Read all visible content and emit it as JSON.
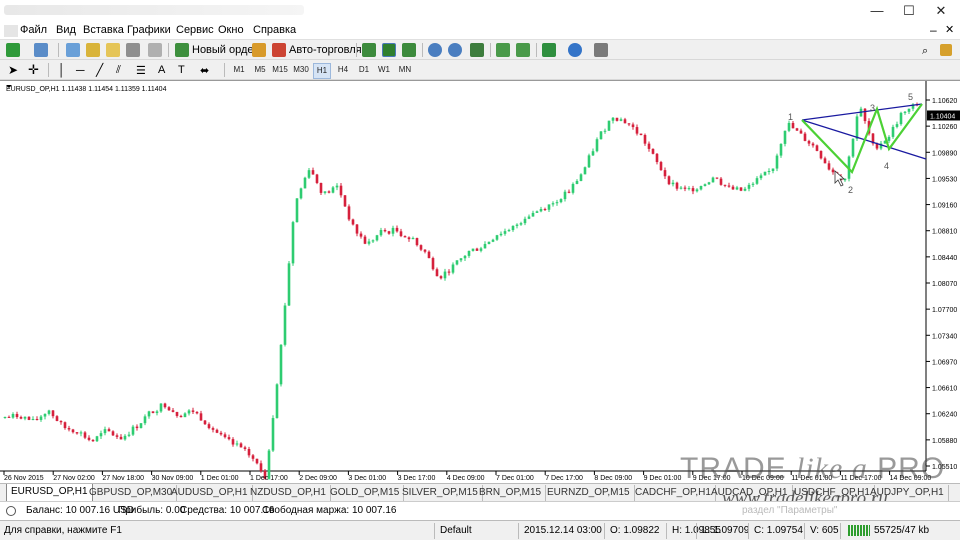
{
  "window": {
    "minimize": "—",
    "maximize": "☐",
    "close": "✕"
  },
  "menu": [
    "Файл",
    "Вид",
    "Вставка",
    "Графики",
    "Сервис",
    "Окно",
    "Справка"
  ],
  "toolbar": {
    "new_order": "Новый ордер",
    "auto_trading": "Авто-торговля"
  },
  "timeframes": [
    "M1",
    "M5",
    "M15",
    "M30",
    "H1",
    "H4",
    "D1",
    "W1",
    "MN"
  ],
  "active_timeframe": "H1",
  "chart": {
    "header": "EURUSD_OP,H1  1.11438 1.11454 1.11359 1.11404",
    "current_price": "1.10404",
    "bull_color": "#2ecc71",
    "bear_color": "#d6203c",
    "pattern_color": "#4cd135",
    "trendline_color": "#1a1aa0",
    "pattern_labels": [
      "1",
      "2",
      "3",
      "4",
      "5"
    ]
  },
  "chart_data": {
    "type": "candlestick",
    "symbol": "EURUSD_OP",
    "timeframe": "H1",
    "ohlc_last": {
      "open": 1.11438,
      "high": 1.11454,
      "low": 1.11359,
      "close": 1.11404
    },
    "y_ticks": [
      "1.10620",
      "1.10260",
      "1.09890",
      "1.09530",
      "1.09160",
      "1.08810",
      "1.08440",
      "1.08070",
      "1.07700",
      "1.07340",
      "1.06970",
      "1.06610",
      "1.06240",
      "1.05880",
      "1.05510"
    ],
    "x_ticks": [
      "26 Nov 2015",
      "27 Nov 02:00",
      "27 Nov 18:00",
      "30 Nov 09:00",
      "1 Dec 01:00",
      "1 Dec 17:00",
      "2 Dec 09:00",
      "3 Dec 01:00",
      "3 Dec 17:00",
      "4 Dec 09:00",
      "7 Dec 01:00",
      "7 Dec 17:00",
      "8 Dec 09:00",
      "9 Dec 01:00",
      "9 Dec 17:00",
      "10 Dec 09:00",
      "11 Dec 01:00",
      "11 Dec 17:00",
      "14 Dec 09:00"
    ],
    "path_prices": [
      1.0618,
      1.0622,
      1.0612,
      1.063,
      1.0605,
      1.06,
      1.0585,
      1.06,
      1.059,
      1.0605,
      1.0625,
      1.0638,
      1.0622,
      1.0628,
      1.061,
      1.059,
      1.0578,
      1.0565,
      1.0535,
      1.0705,
      1.0915,
      1.0968,
      1.093,
      1.0942,
      1.0885,
      1.086,
      1.0878,
      1.088,
      1.0868,
      1.085,
      1.0815,
      1.083,
      1.085,
      1.0858,
      1.0875,
      1.0882,
      1.09,
      1.091,
      1.092,
      1.0935,
      1.0965,
      1.101,
      1.104,
      1.103,
      1.101,
      1.0975,
      1.0945,
      1.0935,
      1.0942,
      1.0955,
      1.0938,
      1.0935,
      1.095,
      1.0965,
      1.103,
      1.1012,
      1.0995,
      1.0965,
      1.095,
      1.1055,
      1.0995,
      1.101,
      1.1045,
      1.1055
    ]
  },
  "tabs": [
    "EURUSD_OP,H1",
    "GBPUSD_OP,M30",
    "AUDUSD_OP,H1",
    "NZDUSD_OP,H1",
    "GOLD_OP,M15",
    "SILVER_OP,M15",
    "BRN_OP,M15",
    "EURNZD_OP,M15",
    "CADCHF_OP,H1",
    "AUDCAD_OP,H1",
    "USDCHF_OP,H1",
    "AUDJPY_OP,H1"
  ],
  "balance": {
    "balance": "Баланс: 10 007.16 USD",
    "profit": "Прибыль: 0.00",
    "equity": "Средства: 10 007.16",
    "free_margin": "Свободная маржа: 10 007.16"
  },
  "status": {
    "help": "Для справки, нажмите F1",
    "profile": "Default",
    "datetime": "2015.12.14 03:00",
    "open": "O: 1.09822",
    "high": "H: 1.09855",
    "low": "L: 1.09709",
    "close": "C: 1.09754",
    "volume": "V: 605",
    "traffic": "55725/47 kb"
  },
  "watermark": {
    "brand_plain": "TRADE ",
    "brand_italic": "like a",
    "brand_end": " PRO",
    "url": "www.tradelikeapro.ru",
    "overlay": "раздел \"Параметры\""
  }
}
